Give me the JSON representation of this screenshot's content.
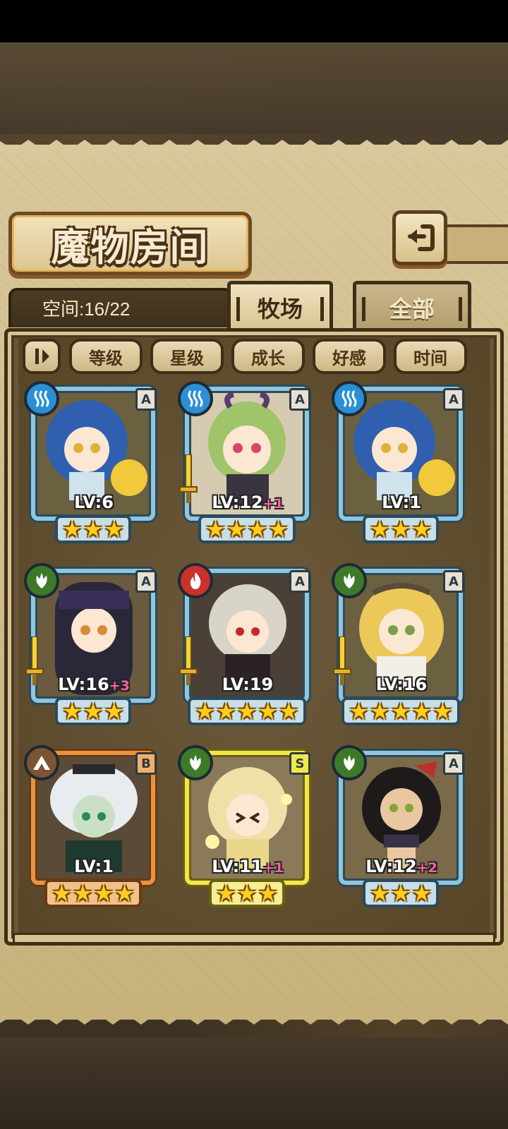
{
  "header": {
    "title": "魔物房间"
  },
  "storage": {
    "space_text": "空间:16/22"
  },
  "tabs": [
    {
      "label": "牧场",
      "active": true
    },
    {
      "label": "全部",
      "active": false
    }
  ],
  "sort_buttons": [
    {
      "label": "等级"
    },
    {
      "label": "星级"
    },
    {
      "label": "成长"
    },
    {
      "label": "好感"
    },
    {
      "label": "时间"
    }
  ],
  "colors": {
    "frame_blue": "#8fc6dd",
    "frame_orange": "#e7933f",
    "frame_yellow": "#f3e64a",
    "element_water": "#2a8fd6",
    "element_nature": "#3c7a2a",
    "element_fire": "#c9312a",
    "element_earth": "#7a5433",
    "bonus_pink": "#ff5fa8"
  },
  "monsters": [
    {
      "element": "water-icon",
      "rank": "A",
      "lv": "LV:6",
      "bonus": "",
      "stars": 3,
      "frame": "blue",
      "weapon": false
    },
    {
      "element": "water-icon",
      "rank": "A",
      "lv": "LV:12",
      "bonus": "+1",
      "stars": 4,
      "frame": "blue",
      "weapon": true
    },
    {
      "element": "water-icon",
      "rank": "A",
      "lv": "LV:1",
      "bonus": "",
      "stars": 3,
      "frame": "blue",
      "weapon": false
    },
    {
      "element": "leaf-icon",
      "rank": "A",
      "lv": "LV:16",
      "bonus": "+3",
      "stars": 3,
      "frame": "blue",
      "weapon": true
    },
    {
      "element": "flame-icon",
      "rank": "A",
      "lv": "LV:19",
      "bonus": "",
      "stars": 5,
      "frame": "blue",
      "weapon": true
    },
    {
      "element": "leaf-icon",
      "rank": "A",
      "lv": "LV:16",
      "bonus": "",
      "stars": 5,
      "frame": "blue",
      "weapon": true
    },
    {
      "element": "mountain-icon",
      "rank": "B",
      "lv": "LV:1",
      "bonus": "",
      "stars": 4,
      "frame": "orange",
      "weapon": false
    },
    {
      "element": "leaf-icon",
      "rank": "S",
      "lv": "LV:11",
      "bonus": "+1",
      "stars": 3,
      "frame": "yellow",
      "weapon": false
    },
    {
      "element": "leaf-icon",
      "rank": "A",
      "lv": "LV:12",
      "bonus": "+2",
      "stars": 3,
      "frame": "blue",
      "weapon": false
    }
  ]
}
